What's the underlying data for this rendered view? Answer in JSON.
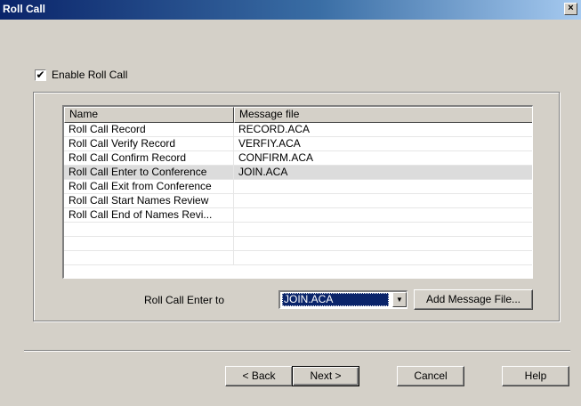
{
  "window": {
    "title": "Roll Call",
    "close_label": "×"
  },
  "enable": {
    "label": "Enable Roll Call",
    "checked": true,
    "check_glyph": "✔"
  },
  "list": {
    "columns": [
      "Name",
      "Message file"
    ],
    "rows": [
      [
        "Roll Call Record",
        "RECORD.ACA"
      ],
      [
        "Roll Call Verify Record",
        "VERFIY.ACA"
      ],
      [
        "Roll Call Confirm Record",
        "CONFIRM.ACA"
      ],
      [
        "Roll Call Enter to Conference",
        "JOIN.ACA"
      ],
      [
        "Roll Call Exit from Conference",
        ""
      ],
      [
        "Roll Call Start Names Review",
        ""
      ],
      [
        "Roll Call End of Names Revi...",
        ""
      ]
    ],
    "selected_index": 3
  },
  "combo": {
    "label": "Roll Call Enter to",
    "value": "JOIN.ACA",
    "arrow_glyph": "▼"
  },
  "buttons": {
    "add_message_file": "Add Message File...",
    "back": "< Back",
    "next": "Next >",
    "cancel": "Cancel",
    "help": "Help"
  }
}
